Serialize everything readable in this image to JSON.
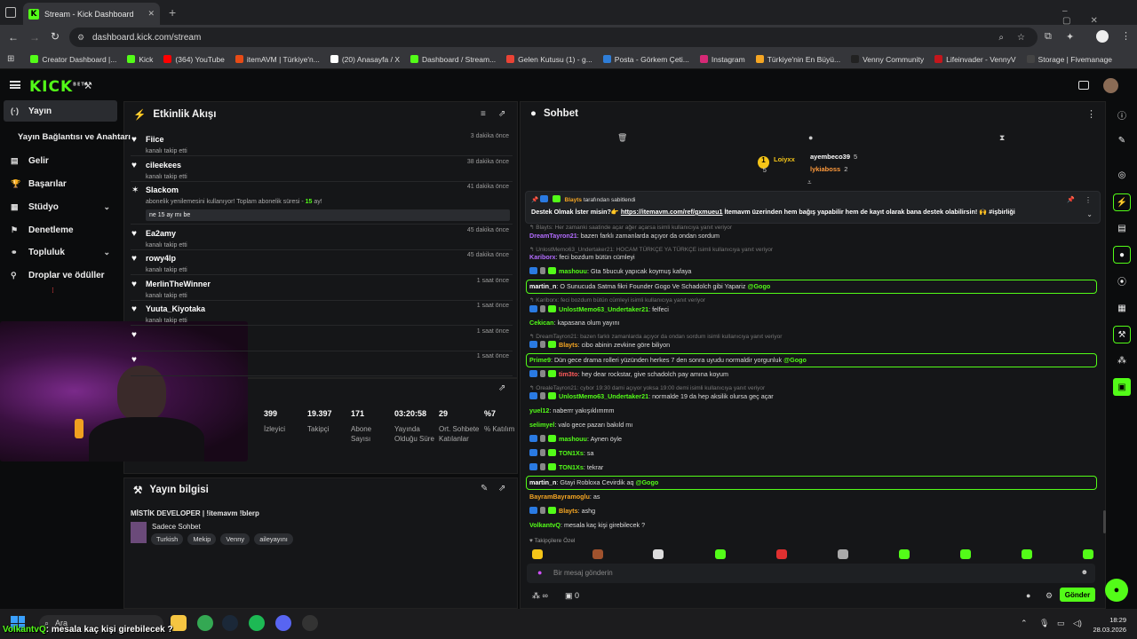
{
  "browser": {
    "tab_title": "Stream - Kick Dashboard",
    "new_tab": "+",
    "url": "dashboard.kick.com/stream",
    "bookmarks": [
      {
        "label": "Creator Dashboard |...",
        "color": "#53fc18"
      },
      {
        "label": "Kick",
        "color": "#53fc18"
      },
      {
        "label": "(364) YouTube",
        "color": "#ff0000"
      },
      {
        "label": "itemAVM | Türkiye'n...",
        "color": "#e84b16"
      },
      {
        "label": "(20) Anasayfa / X",
        "color": "#ffffff"
      },
      {
        "label": "Dashboard / Stream...",
        "color": "#53fc18"
      },
      {
        "label": "Gelen Kutusu (1) - g...",
        "color": "#ea4335"
      },
      {
        "label": "Posta - Görkem Çeti...",
        "color": "#2f7ed8"
      },
      {
        "label": "Instagram",
        "color": "#d62976"
      },
      {
        "label": "Türkiye'nin En Büyü...",
        "color": "#f5a623"
      },
      {
        "label": "Venny Community",
        "color": "#222222"
      },
      {
        "label": "Lifeinvader - VennyV",
        "color": "#c4161c"
      },
      {
        "label": "Storage | Fivemanage",
        "color": "#444444"
      }
    ]
  },
  "header": {
    "logo": "KICK",
    "logo_sup": "BETA"
  },
  "sidebar": {
    "items": [
      {
        "label": "Yayın",
        "icon": "broadcast-icon"
      },
      {
        "label": "Yayın Bağlantısı ve Anahtarı",
        "icon": ""
      },
      {
        "label": "Gelir",
        "icon": "revenue-icon"
      },
      {
        "label": "Başarılar",
        "icon": "trophy-icon"
      },
      {
        "label": "Stüdyo",
        "icon": "studio-icon"
      },
      {
        "label": "Denetleme",
        "icon": "moderation-icon"
      },
      {
        "label": "Topluluk",
        "icon": "community-icon"
      },
      {
        "label": "Droplar ve ödüller",
        "icon": "drops-icon"
      }
    ]
  },
  "activity": {
    "title": "Etkinlik Akışı",
    "events": [
      {
        "name": "Fiice",
        "sub": "kanalı takip etti",
        "time": "3 dakika önce",
        "icon": "heart"
      },
      {
        "name": "cileekees",
        "sub": "kanalı takip etti",
        "time": "38 dakika önce",
        "icon": "heart"
      },
      {
        "name": "Slackom",
        "sub_pre": "abonelik yenilemesini kullanıyor! Toplam abonelik süresi - ",
        "sub_num": "15",
        "sub_post": " ay!",
        "note": "ne 15 ay mı be",
        "time": "41 dakika önce",
        "icon": "star"
      },
      {
        "name": "Ea2amy",
        "sub": "kanalı takip etti",
        "time": "45 dakika önce",
        "icon": "heart"
      },
      {
        "name": "rowy4lp",
        "sub": "kanalı takip etti",
        "time": "45 dakika önce",
        "icon": "heart"
      },
      {
        "name": "MerlinTheWinner",
        "sub": "kanalı takip etti",
        "time": "1 saat önce",
        "icon": "heart"
      },
      {
        "name": "Yuuta_Kiyotaka",
        "sub": "kanalı takip etti",
        "time": "1 saat önce",
        "icon": "heart"
      },
      {
        "name": "",
        "sub": "",
        "time": "1 saat önce",
        "icon": "heart"
      },
      {
        "name": "",
        "sub": "",
        "time": "1 saat önce",
        "icon": "heart"
      }
    ]
  },
  "stats": [
    {
      "value": "399",
      "label": "İzleyici"
    },
    {
      "value": "19.397",
      "label": "Takipçi"
    },
    {
      "value": "171",
      "label": "Abone Sayısı"
    },
    {
      "value": "03:20:58",
      "label": "Yayında Olduğu Süre"
    },
    {
      "value": "29",
      "label": "Ort. Sohbete Katılanlar"
    },
    {
      "value": "%7",
      "label": "% Katılım"
    }
  ],
  "stream_info": {
    "title_label": "Yayın bilgisi",
    "stream_title": "MİSTİK DEVELOPER | !itemavm !blerp",
    "category": "Sadece Sohbet",
    "tags": [
      "Turkish",
      "Mekip",
      "Venny",
      "aileyayını"
    ]
  },
  "chat": {
    "title": "Sohbet",
    "leaderboard": [
      {
        "name": "Loiyxx",
        "count": "5",
        "color": "#f5c518"
      },
      {
        "name": "ayembeco39",
        "count": "5",
        "color": "#ffffff"
      },
      {
        "name": "lykiaboss",
        "count": "2",
        "color": "#ff9a3c"
      }
    ],
    "pinned_by": "Blayts",
    "pinned_suffix": "tarafından sabitlendi",
    "pinned_text_pre": "Destek Olmak İster misin?👉 ",
    "pinned_link": "https://itemavm.com/ref/gxmueu1",
    "pinned_text_post": " İtemavm üzerinden hem bağış yapabilir hem de kayıt olarak bana destek olabilirsin! 🙌 #işbirliği",
    "messages": [
      {
        "type": "reply",
        "text": "Blayts: Her zamanki saatinde açar ağer açarsa isimli kullanıcıya yanıt veriyor"
      },
      {
        "type": "msg",
        "user": "DreamTayron21",
        "color": "#b36cff",
        "text": "bazen farklı zamanlarda açıyor da ondan sordum"
      },
      {
        "type": "reply",
        "text": "UnlostMemo63_Undertaker21: HOCAM TÜRKÇE YA TÜRKÇE isimli kullanıcıya yanıt veriyor"
      },
      {
        "type": "msg",
        "user": "Kariborx",
        "color": "#b36cff",
        "text": "feci bozdum bütün cümleyi"
      },
      {
        "type": "msg",
        "user": "mashouu",
        "color": "#53fc18",
        "text": "Gta 5bucuk yapıcak koymuş kafaya",
        "badges": true
      },
      {
        "type": "hl",
        "user": "martin_n",
        "color": "#ffffff",
        "text": "O Sunucuda Satma fikri Founder Gogo Ve Schadolch gibi Yapariz",
        "mention": "@Gogo"
      },
      {
        "type": "reply",
        "text": "Kariborx: feci bozdum bütün cümleyi isimli kullanıcıya yanıt veriyor"
      },
      {
        "type": "msg",
        "user": "UnlostMemo63_Undertaker21",
        "color": "#53fc18",
        "text": "felfeci",
        "badges": true
      },
      {
        "type": "msg",
        "user": "Cekican",
        "color": "#53fc18",
        "text": "kapasana olum yayını"
      },
      {
        "type": "reply",
        "text": "DreamTayron21: bazen farklı zamanlarda açıyor da ondan sordum isimli kullanıcıya yanıt veriyor"
      },
      {
        "type": "msg",
        "user": "Blayts",
        "color": "#f5a623",
        "text": "cibo abinin zevkine göre biliyon",
        "badges": true
      },
      {
        "type": "hl",
        "user": "Prime9",
        "color": "#53fc18",
        "text": "Dün gece drama rolleri yüzünden herkes 7 den sonra uyudu normaldir yorgunluk",
        "mention": "@Gogo"
      },
      {
        "type": "msg",
        "user": "tim3to",
        "color": "#ff5b5b",
        "text": "hey dear rockstar, give schadolch pay amına koyum",
        "badges": true
      },
      {
        "type": "reply",
        "text": "OrealeTayron21: cybor 19:30 dami açıyor yoksa 19:00 demi isimli kullanıcıya yanıt veriyor"
      },
      {
        "type": "msg",
        "user": "UnlostMemo63_Undertaker21",
        "color": "#53fc18",
        "text": "normalde 19 da hep aksilik olursa geç açar",
        "badges": true
      },
      {
        "type": "msg",
        "user": "yuel12",
        "color": "#53fc18",
        "text": "naberrr yakışıklımmm"
      },
      {
        "type": "msg",
        "user": "selimyel",
        "color": "#53fc18",
        "text": "valo gece pazarı bakıld mı"
      },
      {
        "type": "msg",
        "user": "mashouu",
        "color": "#53fc18",
        "text": "Aynen öyle",
        "badges": true
      },
      {
        "type": "msg",
        "user": "TON1Xs",
        "color": "#53fc18",
        "text": "sa",
        "badges": true
      },
      {
        "type": "msg",
        "user": "TON1Xs",
        "color": "#53fc18",
        "text": "tekrar",
        "badges": true
      },
      {
        "type": "hl",
        "user": "martin_n",
        "color": "#ffffff",
        "text": "Gtayi Robloxa Cevirdik aq",
        "mention": "@Gogo"
      },
      {
        "type": "msg",
        "user": "BayramBayramoglu",
        "color": "#f5a623",
        "text": "as"
      },
      {
        "type": "msg",
        "user": "Blayts",
        "color": "#f5a623",
        "text": "ashg",
        "badges": true
      },
      {
        "type": "msg",
        "user": "VolkantvQ",
        "color": "#53fc18",
        "text": "mesala kaç kişi girebilecek ?"
      }
    ],
    "filter_note": "Takipçilere Özel",
    "input_placeholder": "Bir mesaj gönderin",
    "points_infinity": "∞",
    "points_count": "0",
    "send_label": "Gönder"
  },
  "overlay_caption": {
    "user": "VolkantvQ",
    "text": ": mesala kaç kişi girebilecek ?"
  },
  "taskbar": {
    "search": "Ara",
    "time": "18:29",
    "date": "28.03.2026"
  }
}
